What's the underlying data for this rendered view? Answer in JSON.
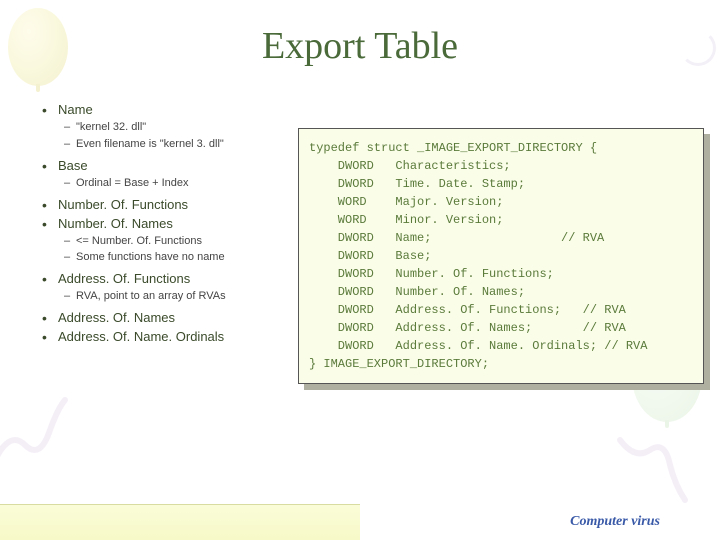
{
  "title": "Export Table",
  "bullets": [
    {
      "label": "Name",
      "sub": [
        "\"kernel 32. dll\"",
        "Even filename is \"kernel 3. dll\""
      ]
    },
    {
      "label": "Base",
      "sub": [
        "Ordinal = Base + Index"
      ]
    },
    {
      "label": "Number. Of. Functions",
      "sub": []
    },
    {
      "label": "Number. Of. Names",
      "sub": [
        "<= Number. Of. Functions",
        "Some functions have no name"
      ]
    },
    {
      "label": "Address. Of. Functions",
      "sub": [
        "RVA, point to an array of RVAs"
      ]
    },
    {
      "label": "Address. Of. Names",
      "sub": []
    },
    {
      "label": "Address. Of. Name. Ordinals",
      "sub": []
    }
  ],
  "code": "typedef struct _IMAGE_EXPORT_DIRECTORY {\n    DWORD   Characteristics;\n    DWORD   Time. Date. Stamp;\n    WORD    Major. Version;\n    WORD    Minor. Version;\n    DWORD   Name;                  // RVA\n    DWORD   Base;\n    DWORD   Number. Of. Functions;\n    DWORD   Number. Of. Names;\n    DWORD   Address. Of. Functions;   // RVA\n    DWORD   Address. Of. Names;       // RVA\n    DWORD   Address. Of. Name. Ordinals; // RVA\n} IMAGE_EXPORT_DIRECTORY;",
  "footer": "Computer virus"
}
